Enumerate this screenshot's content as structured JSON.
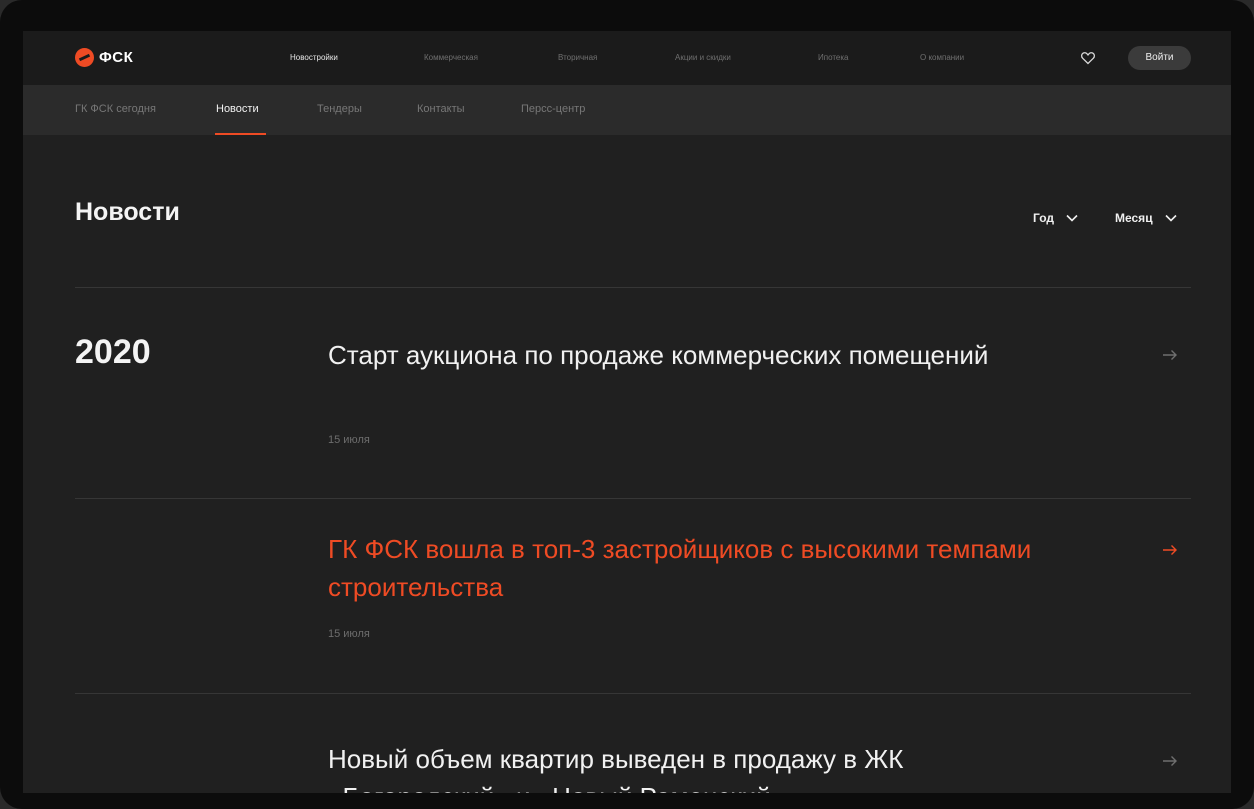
{
  "brand": {
    "name": "ФСК",
    "accent_color": "#ef4b24"
  },
  "top_nav": {
    "items": [
      {
        "label": "Новостройки",
        "active": true
      },
      {
        "label": "Коммерческая",
        "active": false
      },
      {
        "label": "Вторичная",
        "active": false
      },
      {
        "label": "Акции и скидки",
        "active": false
      },
      {
        "label": "Ипотека",
        "active": false
      },
      {
        "label": "О компании",
        "active": false
      }
    ],
    "favorites_icon": "heart-icon",
    "login_label": "Войти"
  },
  "sub_nav": {
    "items": [
      {
        "label": "ГК ФСК сегодня",
        "active": false
      },
      {
        "label": "Новости",
        "active": true
      },
      {
        "label": "Тендеры",
        "active": false
      },
      {
        "label": "Контакты",
        "active": false
      },
      {
        "label": "Персс-центр",
        "active": false
      }
    ]
  },
  "page": {
    "title": "Новости",
    "filters": [
      {
        "label": "Год",
        "icon": "chevron-down-icon"
      },
      {
        "label": "Месяц",
        "icon": "chevron-down-icon"
      }
    ]
  },
  "news": {
    "year": "2020",
    "items": [
      {
        "title": "Старт аукциона по продаже коммерческих помещений",
        "date": "15 июля",
        "highlighted": false
      },
      {
        "title": "ГК ФСК вошла в топ-3 застройщиков с высокими темпами строительства",
        "date": "15 июля",
        "highlighted": true
      },
      {
        "title": "Новый объем квартир выведен в продажу в ЖК «Богородский» и «Новый Раменский»",
        "highlighted": false
      }
    ]
  }
}
